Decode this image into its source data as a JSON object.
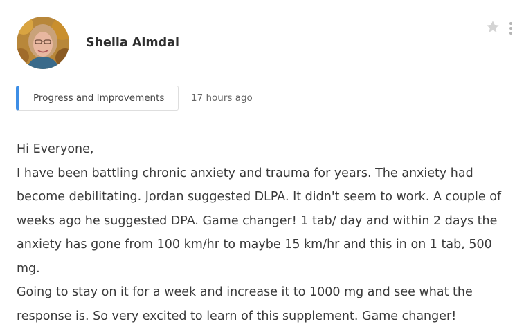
{
  "post": {
    "author_name": "Sheila Almdal",
    "category_label": "Progress and Improvements",
    "timestamp": "17 hours ago",
    "paragraphs": [
      "Hi Everyone,",
      "I have been battling chronic anxiety and trauma for years. The anxiety had become debilitating. Jordan suggested DLPA. It didn't seem to work. A couple of weeks ago he suggested DPA. Game changer! 1 tab/ day and within 2 days the anxiety has gone from 100 km/hr to maybe 15 km/hr and this in on 1 tab, 500 mg.",
      "Going to stay on it for a week and increase it to 1000 mg and see what the response is. So very excited to learn of this supplement. Game changer!"
    ]
  },
  "icons": {
    "favorite": "star-icon",
    "menu": "more-vertical-icon"
  },
  "colors": {
    "accent": "#3d8ee6",
    "icon_muted": "#c8c8c8"
  }
}
